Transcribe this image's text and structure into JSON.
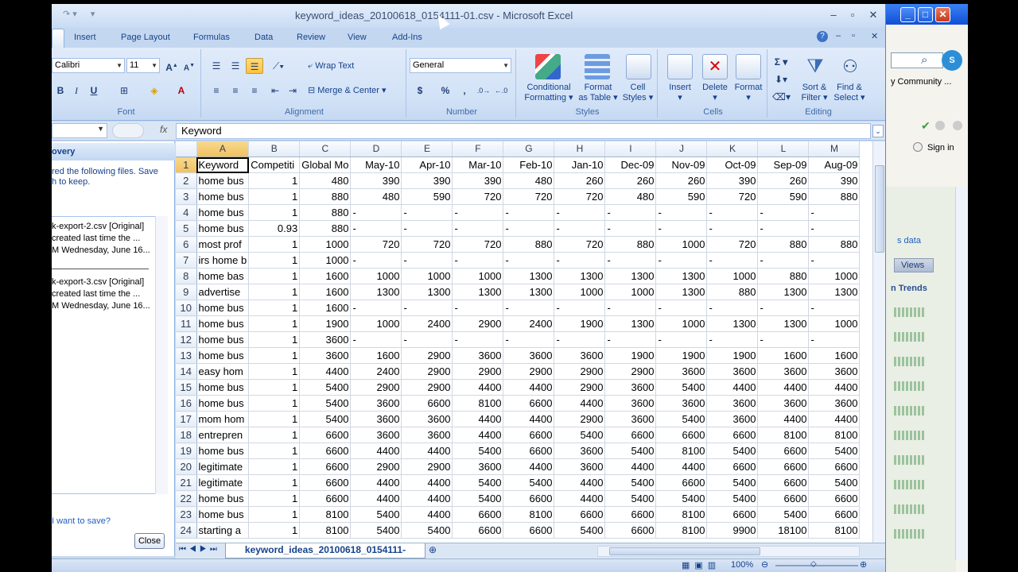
{
  "window": {
    "title": "keyword_ideas_20100618_0154111-01.csv - Microsoft Excel"
  },
  "tabs": [
    "Insert",
    "Page Layout",
    "Formulas",
    "Data",
    "Review",
    "View",
    "Add-Ins"
  ],
  "ribbon": {
    "font": {
      "label": "Font",
      "name": "Calibri",
      "size": "11",
      "bold": "B",
      "italic": "I",
      "underline": "U"
    },
    "alignment": {
      "label": "Alignment",
      "wrap_text": "Wrap Text",
      "merge_center": "Merge & Center"
    },
    "number": {
      "label": "Number",
      "format": "General",
      "currency": "$",
      "percent": "%",
      "comma": ","
    },
    "styles": {
      "label": "Styles",
      "conditional": [
        "Conditional",
        "Formatting"
      ],
      "format_table": [
        "Format",
        "as Table"
      ],
      "cell_styles": [
        "Cell",
        "Styles"
      ]
    },
    "cells": {
      "label": "Cells",
      "insert": "Insert",
      "delete": "Delete",
      "format": "Format"
    },
    "editing": {
      "label": "Editing",
      "sort_filter": [
        "Sort &",
        "Filter"
      ],
      "find_select": [
        "Find &",
        "Select"
      ]
    }
  },
  "formula_bar": {
    "fx": "fx",
    "content": "Keyword"
  },
  "recovery": {
    "title": "overy",
    "intro": [
      "red the following files.  Save",
      "h to keep."
    ],
    "files": [
      {
        "name": "k-export-2.csv  [Original]",
        "note": " created last time the ...",
        "time": "M Wednesday, June 16..."
      },
      {
        "name": "k-export-3.csv  [Original]",
        "note": " created last time the ...",
        "time": "M Wednesday, June 16..."
      }
    ],
    "question": "I want to save?",
    "close": "Close"
  },
  "sheet": {
    "columns": [
      "A",
      "B",
      "C",
      "D",
      "E",
      "F",
      "G",
      "H",
      "I",
      "J",
      "K",
      "L",
      "M"
    ],
    "rows": [
      [
        "Keyword",
        "Competiti",
        "Global Mo",
        "May-10",
        "Apr-10",
        "Mar-10",
        "Feb-10",
        "Jan-10",
        "Dec-09",
        "Nov-09",
        "Oct-09",
        "Sep-09",
        "Aug-09"
      ],
      [
        "home bus",
        "1",
        "480",
        "390",
        "390",
        "390",
        "480",
        "260",
        "260",
        "260",
        "390",
        "260",
        "390"
      ],
      [
        "home bus",
        "1",
        "880",
        "480",
        "590",
        "720",
        "720",
        "720",
        "480",
        "590",
        "720",
        "590",
        "880"
      ],
      [
        "home bus",
        "1",
        "880",
        "-",
        "-",
        "-",
        "-",
        "-",
        "-",
        "-",
        "-",
        "-",
        "-"
      ],
      [
        "home bus",
        "0.93",
        "880",
        "-",
        "-",
        "-",
        "-",
        "-",
        "-",
        "-",
        "-",
        "-",
        "-"
      ],
      [
        "most prof",
        "1",
        "1000",
        "720",
        "720",
        "720",
        "880",
        "720",
        "880",
        "1000",
        "720",
        "880",
        "880"
      ],
      [
        "irs home b",
        "1",
        "1000",
        "-",
        "-",
        "-",
        "-",
        "-",
        "-",
        "-",
        "-",
        "-",
        "-"
      ],
      [
        "home bas",
        "1",
        "1600",
        "1000",
        "1000",
        "1000",
        "1300",
        "1300",
        "1300",
        "1300",
        "1000",
        "880",
        "1000"
      ],
      [
        "advertise",
        "1",
        "1600",
        "1300",
        "1300",
        "1300",
        "1300",
        "1000",
        "1000",
        "1300",
        "880",
        "1300",
        "1300"
      ],
      [
        "home bus",
        "1",
        "1600",
        "-",
        "-",
        "-",
        "-",
        "-",
        "-",
        "-",
        "-",
        "-",
        "-"
      ],
      [
        "home bus",
        "1",
        "1900",
        "1000",
        "2400",
        "2900",
        "2400",
        "1900",
        "1300",
        "1000",
        "1300",
        "1300",
        "1000"
      ],
      [
        "home bus",
        "1",
        "3600",
        "-",
        "-",
        "-",
        "-",
        "-",
        "-",
        "-",
        "-",
        "-",
        "-"
      ],
      [
        "home bus",
        "1",
        "3600",
        "1600",
        "2900",
        "3600",
        "3600",
        "3600",
        "1900",
        "1900",
        "1900",
        "1600",
        "1600"
      ],
      [
        "easy hom",
        "1",
        "4400",
        "2400",
        "2900",
        "2900",
        "2900",
        "2900",
        "2900",
        "3600",
        "3600",
        "3600",
        "3600"
      ],
      [
        "home bus",
        "1",
        "5400",
        "2900",
        "2900",
        "4400",
        "4400",
        "2900",
        "3600",
        "5400",
        "4400",
        "4400",
        "4400"
      ],
      [
        "home bus",
        "1",
        "5400",
        "3600",
        "6600",
        "8100",
        "6600",
        "4400",
        "3600",
        "3600",
        "3600",
        "3600",
        "3600"
      ],
      [
        "mom hom",
        "1",
        "5400",
        "3600",
        "3600",
        "4400",
        "4400",
        "2900",
        "3600",
        "5400",
        "3600",
        "4400",
        "4400"
      ],
      [
        "entrepren",
        "1",
        "6600",
        "3600",
        "3600",
        "4400",
        "6600",
        "5400",
        "6600",
        "6600",
        "6600",
        "8100",
        "8100"
      ],
      [
        "home bus",
        "1",
        "6600",
        "4400",
        "4400",
        "5400",
        "6600",
        "3600",
        "5400",
        "8100",
        "5400",
        "6600",
        "5400"
      ],
      [
        "legitimate",
        "1",
        "6600",
        "2900",
        "2900",
        "3600",
        "4400",
        "3600",
        "4400",
        "4400",
        "6600",
        "6600",
        "6600"
      ],
      [
        "legitimate",
        "1",
        "6600",
        "4400",
        "4400",
        "5400",
        "5400",
        "4400",
        "5400",
        "6600",
        "5400",
        "6600",
        "5400"
      ],
      [
        "home bus",
        "1",
        "6600",
        "4400",
        "4400",
        "5400",
        "6600",
        "4400",
        "5400",
        "5400",
        "5400",
        "6600",
        "6600"
      ],
      [
        "home bus",
        "1",
        "8100",
        "5400",
        "4400",
        "6600",
        "8100",
        "6600",
        "6600",
        "8100",
        "6600",
        "5400",
        "6600"
      ],
      [
        "starting a",
        "1",
        "8100",
        "5400",
        "5400",
        "6600",
        "6600",
        "5400",
        "6600",
        "8100",
        "9900",
        "18100",
        "8100"
      ]
    ],
    "sheet_tab": "keyword_ideas_20100618_0154111-"
  },
  "status": {
    "zoom": "100%"
  },
  "background_window": {
    "community": "y Community ...",
    "signin": "Sign in",
    "data_link": "s data",
    "views": "Views",
    "trends": "n Trends"
  }
}
